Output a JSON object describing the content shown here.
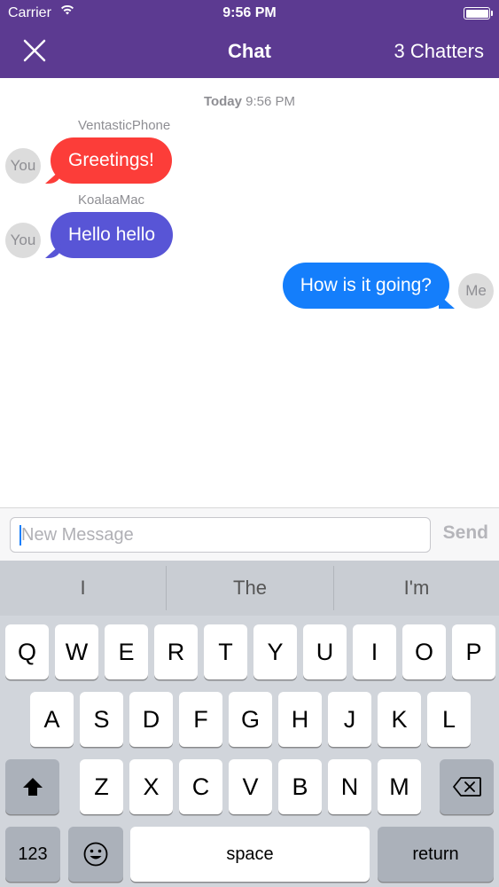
{
  "status_bar": {
    "carrier": "Carrier",
    "time": "9:56 PM"
  },
  "nav": {
    "title": "Chat",
    "chatters": "3 Chatters",
    "close_icon": "close-icon"
  },
  "chat": {
    "date_day": "Today",
    "date_time": "9:56 PM",
    "messages": [
      {
        "sender": "VentasticPhone",
        "avatar": "You",
        "text": "Greetings!",
        "color": "#fc3d39",
        "side": "left"
      },
      {
        "sender": "KoalaaMac",
        "avatar": "You",
        "text": "Hello hello",
        "color": "#5855d6",
        "side": "left"
      },
      {
        "sender": "",
        "avatar": "Me",
        "text": "How is it going?",
        "color": "#147efb",
        "side": "right"
      }
    ]
  },
  "input": {
    "placeholder": "New Message",
    "value": "",
    "send_label": "Send"
  },
  "keyboard": {
    "suggestions": [
      "I",
      "The",
      "I'm"
    ],
    "row1": [
      "Q",
      "W",
      "E",
      "R",
      "T",
      "Y",
      "U",
      "I",
      "O",
      "P"
    ],
    "row2": [
      "A",
      "S",
      "D",
      "F",
      "G",
      "H",
      "J",
      "K",
      "L"
    ],
    "row3": [
      "Z",
      "X",
      "C",
      "V",
      "B",
      "N",
      "M"
    ],
    "numbers_label": "123",
    "space_label": "space",
    "return_label": "return",
    "shift_icon": "shift-icon",
    "backspace_icon": "backspace-icon",
    "emoji_icon": "emoji-icon"
  }
}
